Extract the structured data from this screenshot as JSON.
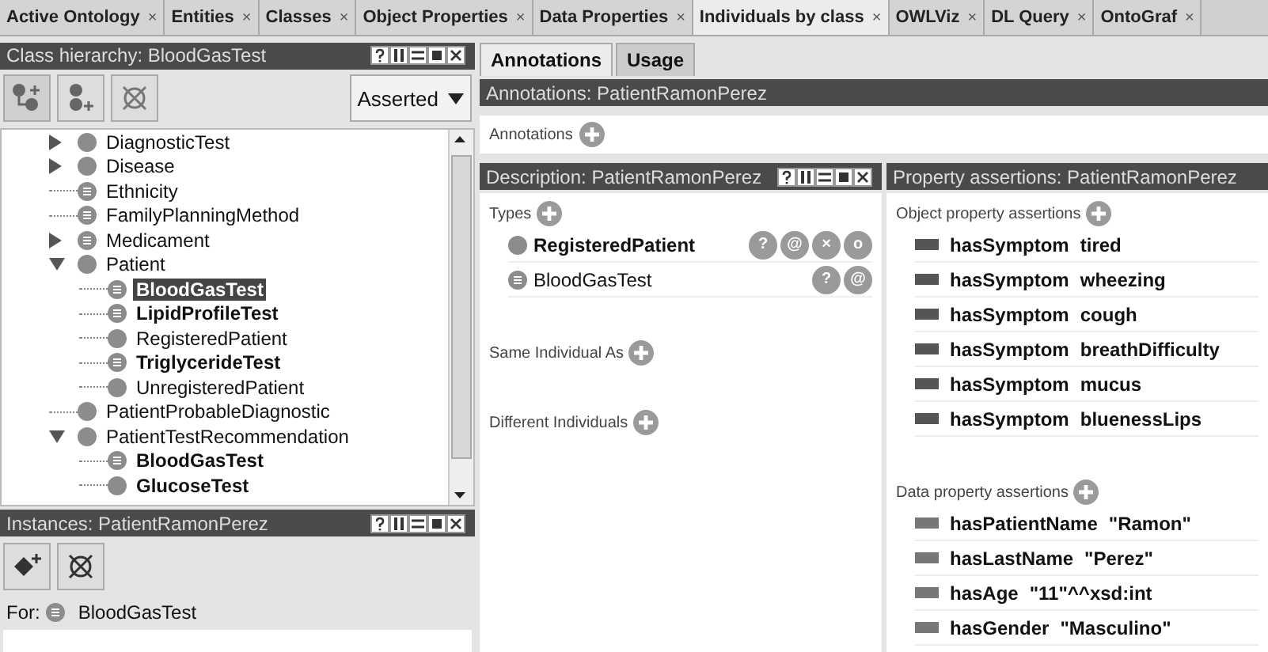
{
  "tabs": [
    {
      "label": "Active Ontology",
      "selected": false
    },
    {
      "label": "Entities",
      "selected": false
    },
    {
      "label": "Classes",
      "selected": false
    },
    {
      "label": "Object Properties",
      "selected": false
    },
    {
      "label": "Data Properties",
      "selected": false
    },
    {
      "label": "Individuals by class",
      "selected": true
    },
    {
      "label": "OWLViz",
      "selected": false
    },
    {
      "label": "DL Query",
      "selected": false
    },
    {
      "label": "OntoGraf",
      "selected": false
    }
  ],
  "tab_close": "×",
  "class_hierarchy": {
    "title": "Class hierarchy: BloodGasTest",
    "mode": "Asserted",
    "tree": [
      {
        "name": "DiagnosticTest",
        "kind": "primitive",
        "bold": false,
        "selected": false,
        "expanded": false
      },
      {
        "name": "Disease",
        "kind": "primitive",
        "bold": false,
        "selected": false,
        "expanded": false
      },
      {
        "name": "Ethnicity",
        "kind": "defined",
        "bold": false,
        "selected": false
      },
      {
        "name": "FamilyPlanningMethod",
        "kind": "defined",
        "bold": false,
        "selected": false
      },
      {
        "name": "Medicament",
        "kind": "defined",
        "bold": false,
        "selected": false,
        "expanded": false
      },
      {
        "name": "Patient",
        "kind": "primitive",
        "bold": false,
        "selected": false,
        "expanded": true,
        "children": [
          {
            "name": "BloodGasTest",
            "kind": "defined",
            "bold": true,
            "selected": true
          },
          {
            "name": "LipidProfileTest",
            "kind": "defined",
            "bold": true,
            "selected": false
          },
          {
            "name": "RegisteredPatient",
            "kind": "primitive",
            "bold": false,
            "selected": false
          },
          {
            "name": "TriglycerideTest",
            "kind": "defined",
            "bold": true,
            "selected": false
          },
          {
            "name": "UnregisteredPatient",
            "kind": "primitive",
            "bold": false,
            "selected": false
          }
        ]
      },
      {
        "name": "PatientProbableDiagnostic",
        "kind": "primitive",
        "bold": false,
        "selected": false
      },
      {
        "name": "PatientTestRecommendation",
        "kind": "primitive",
        "bold": false,
        "selected": false,
        "expanded": true,
        "children": [
          {
            "name": "BloodGasTest",
            "kind": "defined",
            "bold": true,
            "selected": false
          },
          {
            "name": "GlucoseTest",
            "kind": "primitive",
            "bold": true,
            "selected": false
          }
        ]
      }
    ]
  },
  "instances": {
    "title": "Instances: PatientRamonPerez",
    "for_label": "For:",
    "for_class": "BloodGasTest"
  },
  "right_tabs": [
    {
      "label": "Annotations",
      "selected": true
    },
    {
      "label": "Usage",
      "selected": false
    }
  ],
  "annotations": {
    "title": "Annotations: PatientRamonPerez",
    "label": "Annotations"
  },
  "description": {
    "title": "Description: PatientRamonPerez",
    "types_label": "Types",
    "types": [
      {
        "name": "RegisteredPatient",
        "kind": "primitive",
        "bold": true,
        "actions": [
          "?",
          "@",
          "×",
          "o"
        ]
      },
      {
        "name": "BloodGasTest",
        "kind": "defined",
        "bold": false,
        "actions": [
          "?",
          "@"
        ]
      }
    ],
    "same_label": "Same Individual As",
    "different_label": "Different Individuals"
  },
  "property_assertions": {
    "title": "Property assertions: PatientRamonPerez",
    "object_label": "Object property assertions",
    "object": [
      {
        "property": "hasSymptom",
        "value": "tired"
      },
      {
        "property": "hasSymptom",
        "value": "wheezing"
      },
      {
        "property": "hasSymptom",
        "value": "cough"
      },
      {
        "property": "hasSymptom",
        "value": "breathDifficulty"
      },
      {
        "property": "hasSymptom",
        "value": "mucus"
      },
      {
        "property": "hasSymptom",
        "value": "bluenessLips"
      }
    ],
    "data_label": "Data property assertions",
    "data": [
      {
        "property": "hasPatientName",
        "value": "\"Ramon\""
      },
      {
        "property": "hasLastName",
        "value": "\"Perez\""
      },
      {
        "property": "hasAge",
        "value": "\"11\"^^xsd:int"
      },
      {
        "property": "hasGender",
        "value": "\"Masculino\""
      }
    ]
  }
}
